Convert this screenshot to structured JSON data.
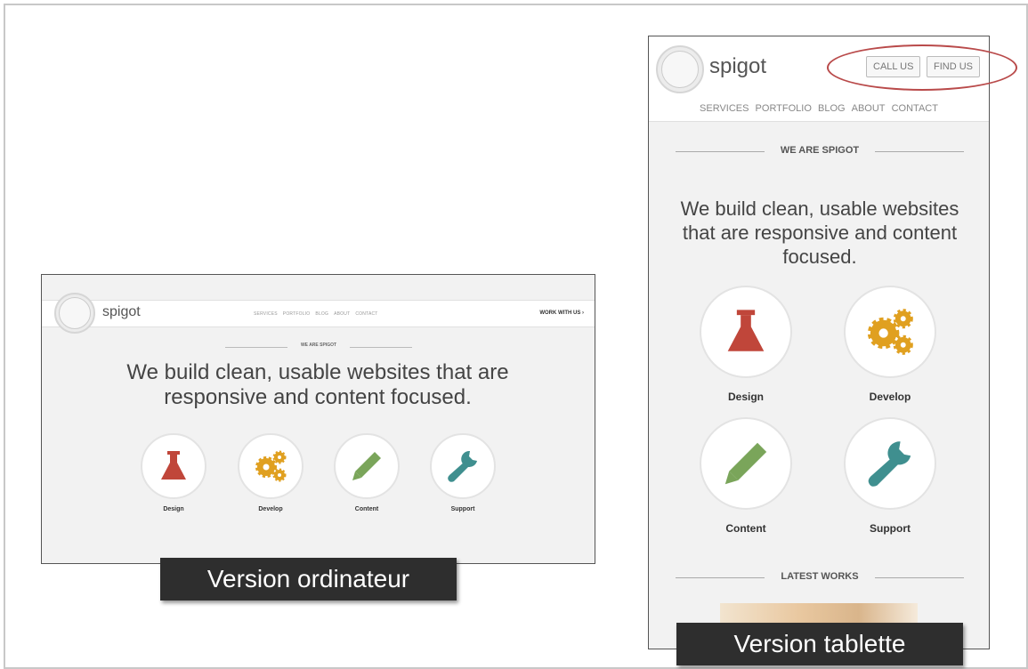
{
  "desktop": {
    "brand": "spigot",
    "nav": [
      "SERVICES",
      "PORTFOLIO",
      "BLOG",
      "ABOUT",
      "CONTACT"
    ],
    "cta": "WORK WITH US ›",
    "section_title": "WE ARE SPIGOT",
    "hero": "We build clean, usable websites that are responsive and content focused.",
    "services": [
      "Design",
      "Develop",
      "Content",
      "Support"
    ]
  },
  "tablet": {
    "brand": "spigot",
    "buttons": {
      "call": "CALL US",
      "find": "FIND US"
    },
    "nav": [
      "SERVICES",
      "PORTFOLIO",
      "BLOG",
      "ABOUT",
      "CONTACT"
    ],
    "section_title": "WE ARE SPIGOT",
    "hero": "We build clean, usable websites that are responsive and content focused.",
    "services": [
      "Design",
      "Develop",
      "Content",
      "Support"
    ],
    "latest_works": "LATEST WORKS"
  },
  "captions": {
    "desktop": "Version ordinateur",
    "tablet": "Version tablette"
  },
  "colors": {
    "design_icon": "#c0463a",
    "develop_icon": "#e0a020",
    "content_icon": "#7aa55a",
    "support_icon": "#3f8f8f",
    "highlight_ellipse": "#b94a4a"
  },
  "icons": [
    "flask-icon",
    "gears-icon",
    "pencil-icon",
    "wrench-icon",
    "spigot-logo-icon"
  ]
}
